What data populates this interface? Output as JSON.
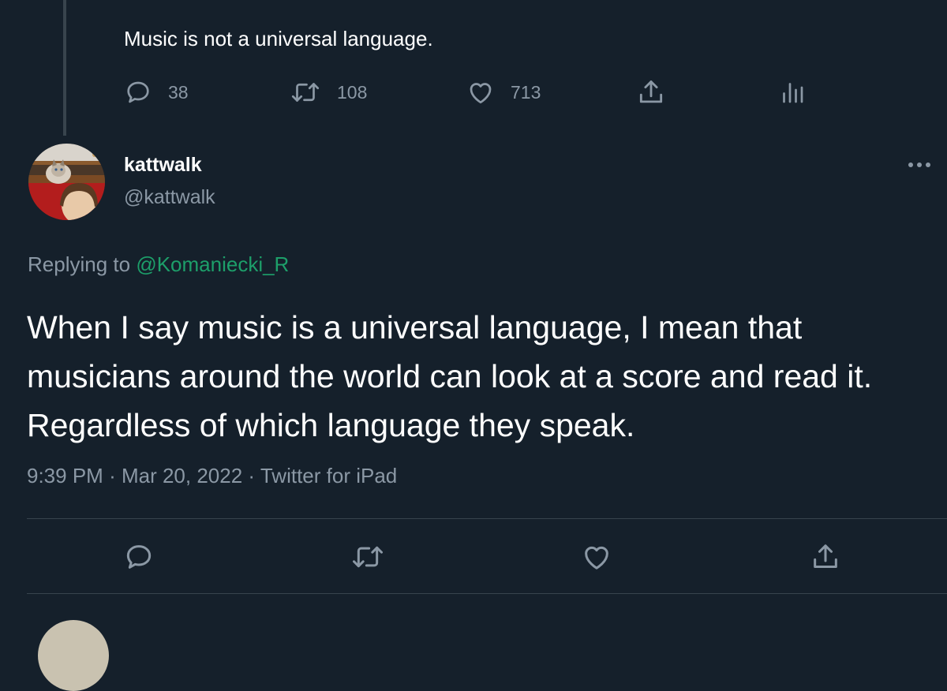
{
  "parent_tweet": {
    "text": "Music is not a universal language.",
    "reply_count": "38",
    "retweet_count": "108",
    "like_count": "713"
  },
  "main_tweet": {
    "author_name": "kattwalk",
    "author_handle": "@kattwalk",
    "replying_prefix": "Replying to",
    "replying_to": "@Komaniecki_R",
    "text": "When I say music is a universal language, I mean that musicians around the world can look at a score and read it. Regardless of which language they speak.",
    "time": "9:39 PM",
    "date": "Mar 20, 2022",
    "source": "Twitter for iPad",
    "separator": "·"
  },
  "icons": {
    "reply": "reply-icon",
    "retweet": "retweet-icon",
    "like": "heart-icon",
    "share": "share-icon",
    "analytics": "analytics-icon",
    "more": "more-icon"
  },
  "colors": {
    "background": "#15202b",
    "text_primary": "#ffffff",
    "text_secondary": "#8b98a5",
    "mention": "#1d9f6a",
    "divider": "#38444d"
  }
}
